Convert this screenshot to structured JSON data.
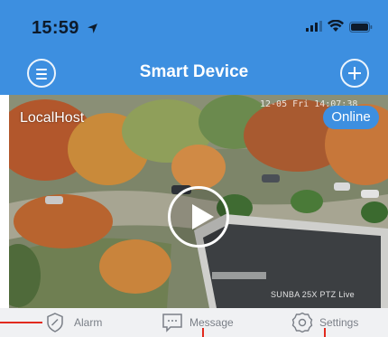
{
  "status_bar": {
    "time": "15:59"
  },
  "nav": {
    "title": "Smart Device"
  },
  "device": {
    "name": "LocalHost",
    "status": "Online",
    "timestamp": "12-05 Fri 14:07:38",
    "camera_label": "SUNBA 25X PTZ Live"
  },
  "tabs": [
    {
      "label": "Alarm",
      "icon": "shield-icon"
    },
    {
      "label": "Message",
      "icon": "chat-icon"
    },
    {
      "label": "Settings",
      "icon": "gear-icon"
    }
  ],
  "colors": {
    "header": "#3d8fe0",
    "online_badge": "#3d8fe0",
    "tabbar": "#f0f1f3",
    "marker": "#e22a1e"
  }
}
